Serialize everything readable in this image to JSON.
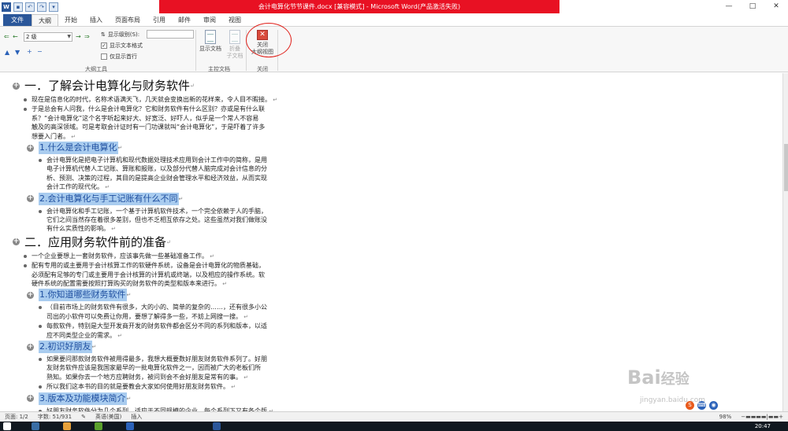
{
  "window": {
    "title": "会计电算化节节课件.docx [兼容模式] - Microsoft Word(产品激活失败)",
    "controls": [
      "—",
      "□",
      "✕"
    ],
    "accent": "#2b579a",
    "title_band_color": "#e81123"
  },
  "quick_access": [
    "W",
    "💾",
    "↶",
    "↷",
    "▾"
  ],
  "tabs": [
    "文件",
    "大纲",
    "开始",
    "插入",
    "页面布局",
    "引用",
    "邮件",
    "审阅",
    "视图"
  ],
  "ribbon": {
    "outline_tools": {
      "level_value": "2 级",
      "show_level_label": "显示级别(S):",
      "show_level_value": "",
      "show_text_format": "显示文本格式",
      "show_first_line": "仅显示首行",
      "group_label": "大纲工具"
    },
    "master_doc": {
      "show_doc": "显示文档",
      "collapse_line1": "折叠",
      "collapse_line2": "子文档",
      "group_label": "主控文档"
    },
    "close": {
      "close_label": "关闭",
      "outline_view_label": "大纲视图",
      "group_label": "关闭"
    }
  },
  "outline": [
    {
      "kind": "h1",
      "text": "一．了解会计电算化与财务软件"
    },
    {
      "kind": "p",
      "lines": [
        "现在是信息化的时代，名称术语满天飞，几天就会变换出新的花样来，令人目不暇接。"
      ]
    },
    {
      "kind": "p",
      "lines": [
        "于是总会有人问我，什么是会计电算化？它和财务软件有什么区别？亦或是有什么联",
        "系？“会计电算化”这个名字听起来好大、好宽泛、好吓人，似乎是一个常人不容易",
        "触及的高深领域。可是考取会计证时有一门功课就叫“会计电算化”，于是吓着了许多",
        "想要入门者。"
      ]
    },
    {
      "kind": "h2",
      "text": "1.什么是会计电算化"
    },
    {
      "kind": "p2",
      "lines": [
        "会计电算化是把电子计算机和现代数据处理技术应用到会计工作中的简称，是用",
        "电子计算机代替人工记账、算账和报账，以及部分代替人脑完成对会计信息的分",
        "析、预测、决策的过程，其目的是提高企业财会管理水平和经济效益，从而实现",
        "会计工作的现代化。"
      ]
    },
    {
      "kind": "h2",
      "text": "2.会计电算化与手工记账有什么不同"
    },
    {
      "kind": "p2",
      "lines": [
        "会计电算化和手工记账，一个基于计算机软件技术，一个完全依赖于人的手脑，",
        "它们之间当然存在着很多差别，但也不乏相互依存之处。这些虽然对我们做账没",
        "有什么实质性的影响。"
      ]
    },
    {
      "kind": "h1",
      "text": "二．应用财务软件前的准备"
    },
    {
      "kind": "p",
      "lines": [
        "一个企业要想上一套财务软件，应该事先做一些基础准备工作。"
      ]
    },
    {
      "kind": "p",
      "lines": [
        "配有专用的或主要用于会计核算工作的软硬件系统，设备是会计电算化的物质基础，",
        "必须配有足够的专门或主要用于会计核算的计算机或终端，以及相应的操作系统。软",
        "硬件系统的配置需要按照打算购买的财务软件的类型和版本来进行。"
      ]
    },
    {
      "kind": "h2",
      "text": "1.你知道哪些财务软件"
    },
    {
      "kind": "p2",
      "lines": [
        "（目前市场上的财务软件有很多，大的小的、简单的复杂的……，还有很多小公",
        "司出的小软件可以免费让你用，要想了解得多一些，不妨上网搜一搜。"
      ]
    },
    {
      "kind": "p2",
      "lines": [
        "每款软件，特别是大型开发商开发的财务软件都会区分不同的系列和版本，以适",
        "应不同类型企业的需求。"
      ]
    },
    {
      "kind": "h2",
      "text": "2.初识好朋友"
    },
    {
      "kind": "p2",
      "lines": [
        "如果要问那款财务软件被用得最多，我想大概要数好朋友财务软件系列了。好朋",
        "友财务软件应该是我国家最早的一批电算化软件之一，因而被广大的老板们所",
        "熟知。如果你去一个地方应聘财务，被问到会不会好朋友是常有的事。"
      ]
    },
    {
      "kind": "p2",
      "lines": [
        "所以我们这本书的目的就是要教会大家如何使用好朋友财务软件。"
      ]
    },
    {
      "kind": "h2",
      "text": "3.版本及功能模块简介"
    },
    {
      "kind": "p2",
      "lines": [
        "好朋友财务软件分为几个系列，适应于不同规模的企业，每个系列下又有各个版"
      ]
    }
  ],
  "statusbar": {
    "page": "页面: 1/2",
    "words": "字数: 51/931",
    "lang": "英语(美国)",
    "mode": "插入",
    "zoom": "98%"
  },
  "watermark": {
    "brand": "Bai经验",
    "url": "jingyan.baidu.com"
  },
  "taskbar": {
    "clock": "20:47"
  }
}
